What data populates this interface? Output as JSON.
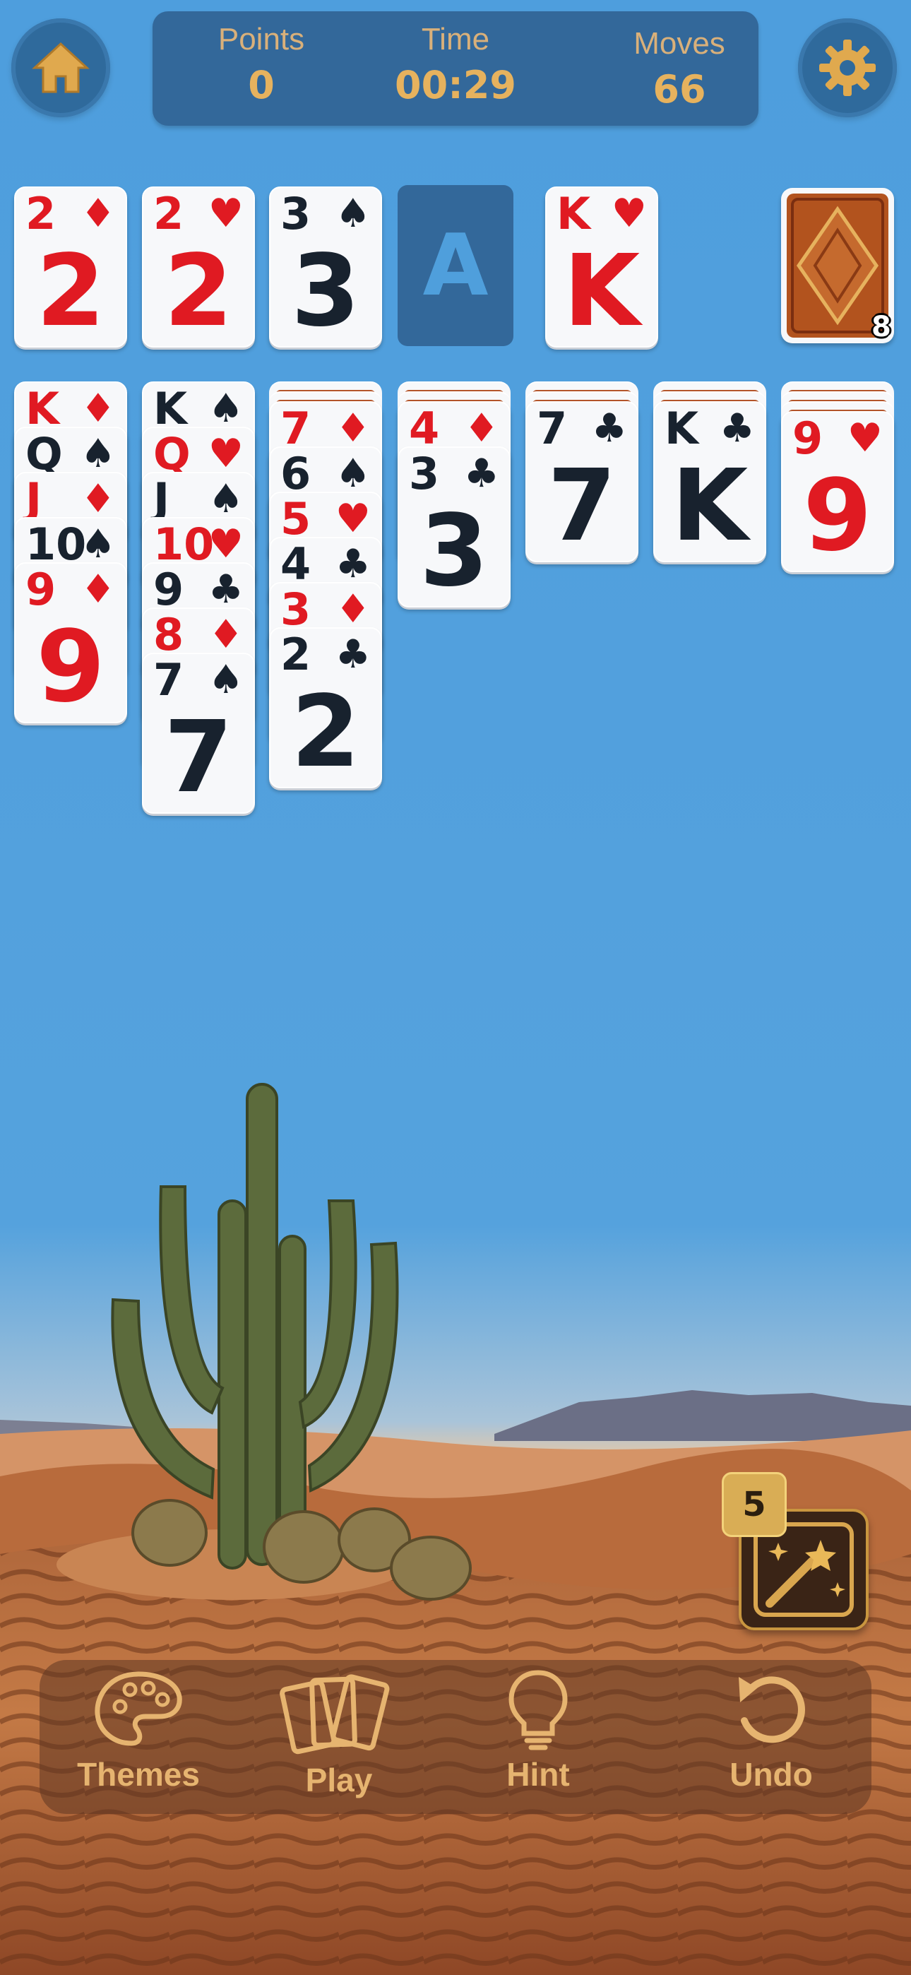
{
  "header": {
    "points_label": "Points",
    "points_value": "0",
    "time_label": "Time",
    "time_value": "00:29",
    "moves_label": "Moves",
    "moves_value": "66"
  },
  "foundation": [
    {
      "rank": "2",
      "suit": "♦",
      "color": "red"
    },
    {
      "rank": "2",
      "suit": "♥",
      "color": "red"
    },
    {
      "rank": "3",
      "suit": "♠",
      "color": "black"
    },
    {
      "rank": "A",
      "empty": true
    }
  ],
  "waste": {
    "rank": "K",
    "suit": "♥",
    "color": "red"
  },
  "stock": {
    "count": "8"
  },
  "tableau": [
    {
      "facedown": 0,
      "cards": [
        {
          "rank": "K",
          "suit": "♦",
          "color": "red"
        },
        {
          "rank": "Q",
          "suit": "♠",
          "color": "black"
        },
        {
          "rank": "J",
          "suit": "♦",
          "color": "red"
        },
        {
          "rank": "10",
          "suit": "♠",
          "color": "black"
        },
        {
          "rank": "9",
          "suit": "♦",
          "color": "red"
        }
      ]
    },
    {
      "facedown": 0,
      "cards": [
        {
          "rank": "K",
          "suit": "♠",
          "color": "black"
        },
        {
          "rank": "Q",
          "suit": "♥",
          "color": "red"
        },
        {
          "rank": "J",
          "suit": "♠",
          "color": "black"
        },
        {
          "rank": "10",
          "suit": "♥",
          "color": "red"
        },
        {
          "rank": "9",
          "suit": "♣",
          "color": "black"
        },
        {
          "rank": "8",
          "suit": "♦",
          "color": "red"
        },
        {
          "rank": "7",
          "suit": "♠",
          "color": "black"
        }
      ]
    },
    {
      "facedown": 2,
      "cards": [
        {
          "rank": "7",
          "suit": "♦",
          "color": "red"
        },
        {
          "rank": "6",
          "suit": "♠",
          "color": "black"
        },
        {
          "rank": "5",
          "suit": "♥",
          "color": "red"
        },
        {
          "rank": "4",
          "suit": "♣",
          "color": "black"
        },
        {
          "rank": "3",
          "suit": "♦",
          "color": "red"
        },
        {
          "rank": "2",
          "suit": "♣",
          "color": "black"
        }
      ]
    },
    {
      "facedown": 2,
      "cards": [
        {
          "rank": "4",
          "suit": "♦",
          "color": "red"
        },
        {
          "rank": "3",
          "suit": "♣",
          "color": "black"
        }
      ]
    },
    {
      "facedown": 2,
      "cards": [
        {
          "rank": "7",
          "suit": "♣",
          "color": "black"
        }
      ]
    },
    {
      "facedown": 2,
      "cards": [
        {
          "rank": "K",
          "suit": "♣",
          "color": "black"
        }
      ]
    },
    {
      "facedown": 3,
      "cards": [
        {
          "rank": "9",
          "suit": "♥",
          "color": "red"
        }
      ]
    }
  ],
  "magic": {
    "count": "5"
  },
  "toolbar": {
    "themes_label": "Themes",
    "play_label": "Play",
    "hint_label": "Hint",
    "undo_label": "Undo"
  },
  "colors": {
    "table_blue": "#4f9fdc",
    "panel_blue": "#33689a",
    "gold": "#e6b25e",
    "red_suit": "#e01a22"
  }
}
